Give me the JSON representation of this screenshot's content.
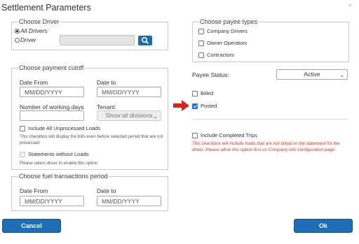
{
  "dialog": {
    "title": "Settlement Parameters",
    "close_glyph": "×"
  },
  "choose_driver": {
    "legend": "Choose Driver",
    "all_drivers": "All Drivers",
    "driver": "Driver"
  },
  "payment_cutoff": {
    "legend": "Choose payment cutoff",
    "date_from_label": "Date From",
    "date_from_placeholder": "MM/DD/YYYY",
    "date_to_label": "Date to",
    "date_to_placeholder": "MM/DD/YYYY",
    "working_days_label": "Number of working days",
    "tenant_label": "Tenant:",
    "tenant_value": "Show all divisions",
    "include_unprocessed_label": "Include All Unprocessed Loads",
    "include_unprocessed_note": "This checkbox will display the bills even before selected period that are not processed",
    "statements_without_loads_label": "Statements without Loads",
    "statements_note": "Please select driver to enable this option"
  },
  "fuel": {
    "legend": "Choose fuel transactions period",
    "date_from_label": "Date From",
    "date_from_placeholder": "MM/DD/YYYY",
    "date_to_label": "Date to",
    "date_to_placeholder": "MM/DD/YYYY"
  },
  "payee_types": {
    "legend": "Choose payee types",
    "items": [
      "Company Drivers",
      "Owner Operators",
      "Contractors"
    ]
  },
  "payee_status": {
    "label": "Payee Status:",
    "value": "Active"
  },
  "status_checks": {
    "billed": "Billed",
    "posted": "Posted"
  },
  "completed_trips": {
    "label": "Include Completed Trips",
    "note": "This checkbox will include loads that are not billed on the statement for the driver. Please allow this option first on Company Info configuration page."
  },
  "footer": {
    "cancel": "Cancel",
    "ok": "Ok"
  },
  "colors": {
    "primary": "#1f6db5",
    "warning_text": "#d93025",
    "arrow": "#e0201b"
  }
}
